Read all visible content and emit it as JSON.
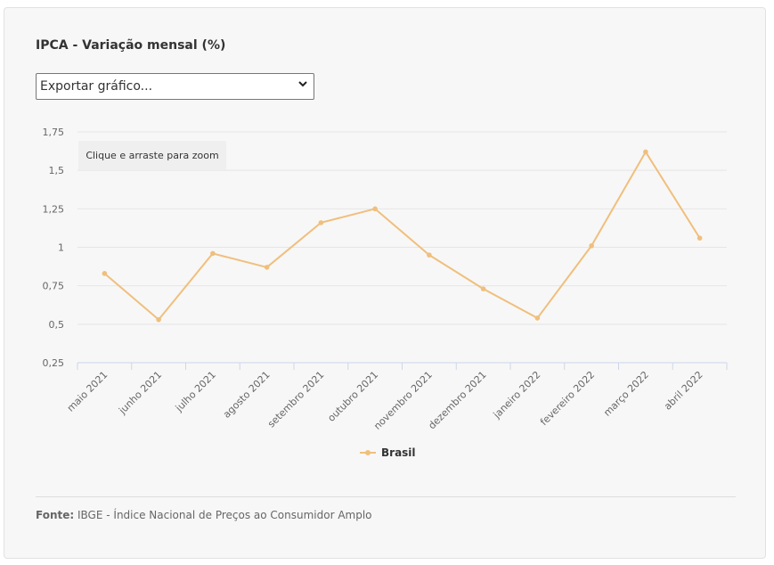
{
  "title": "IPCA - Variação mensal (%)",
  "export_select": {
    "selected": "Exportar gráfico...",
    "icon": "chevron-down-icon"
  },
  "zoom_hint": "Clique e arraste para zoom",
  "source": {
    "label": "Fonte:",
    "text": "IBGE - Índice Nacional de Preços ao Consumidor Amplo"
  },
  "colors": {
    "series": "#f0bf7d",
    "grid": "#e6e6e6",
    "axis": "#ccd6eb"
  },
  "chart_data": {
    "type": "line",
    "title": "IPCA - Variação mensal (%)",
    "xlabel": "",
    "ylabel": "",
    "categories": [
      "maio 2021",
      "junho 2021",
      "julho 2021",
      "agosto 2021",
      "setembro 2021",
      "outubro 2021",
      "novembro 2021",
      "dezembro 2021",
      "janeiro 2022",
      "fevereiro 2022",
      "março 2022",
      "abril 2022"
    ],
    "series": [
      {
        "name": "Brasil",
        "values": [
          0.83,
          0.53,
          0.96,
          0.87,
          1.16,
          1.25,
          0.95,
          0.73,
          0.54,
          1.01,
          1.62,
          1.06
        ]
      }
    ],
    "ylim": [
      0.25,
      1.75
    ],
    "yticks": [
      0.25,
      0.5,
      0.75,
      1,
      1.25,
      1.5,
      1.75
    ],
    "ytick_labels": [
      "0,25",
      "0,5",
      "0,75",
      "1",
      "1,25",
      "1,5",
      "1,75"
    ],
    "grid": true,
    "legend": "bottom-center"
  }
}
